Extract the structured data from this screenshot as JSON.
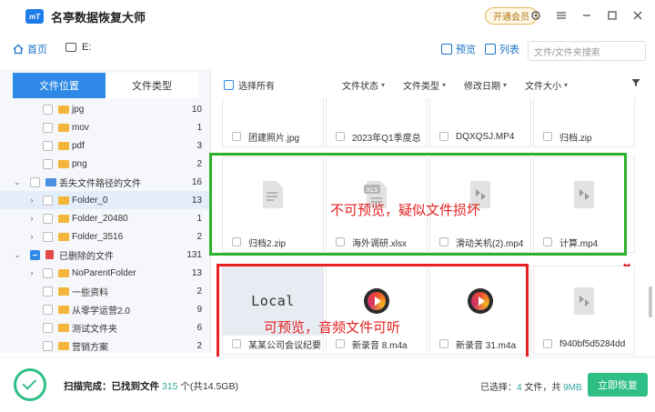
{
  "app": {
    "logo_text": "mT",
    "title": "名亭数据恢复大师",
    "vip_label": "开通会员"
  },
  "addressbar": {
    "home_label": "首页",
    "path": "E:",
    "view_preview": "预览",
    "view_list": "列表",
    "search_placeholder": "文件/文件夹搜索"
  },
  "left_tabs": {
    "location": "文件位置",
    "type": "文件类型"
  },
  "tree": [
    {
      "label": "jpg",
      "count": "10",
      "level": 2
    },
    {
      "label": "mov",
      "count": "1",
      "level": 2
    },
    {
      "label": "pdf",
      "count": "3",
      "level": 2
    },
    {
      "label": "png",
      "count": "2",
      "level": 2
    },
    {
      "label": "丢失文件路径的文件",
      "count": "16",
      "level": 1
    },
    {
      "label": "Folder_0",
      "count": "13",
      "level": 2
    },
    {
      "label": "Folder_20480",
      "count": "1",
      "level": 2
    },
    {
      "label": "Folder_3516",
      "count": "2",
      "level": 2
    },
    {
      "label": "已删除的文件",
      "count": "131",
      "level": 1
    },
    {
      "label": "NoParentFolder",
      "count": "13",
      "level": 2
    },
    {
      "label": "一些资料",
      "count": "2",
      "level": 2
    },
    {
      "label": "从零学运营2.0",
      "count": "9",
      "level": 2
    },
    {
      "label": "测试文件夹",
      "count": "6",
      "level": 2
    },
    {
      "label": "营销方案",
      "count": "2",
      "level": 2
    }
  ],
  "toolbar": {
    "select_all": "选择所有",
    "sort_status": "文件状态",
    "sort_type": "文件类型",
    "sort_date": "修改日期",
    "sort_size": "文件大小"
  },
  "files": {
    "row1": [
      "团建照片.jpg",
      "2023年Q1季度总",
      "DQXQSJ.MP4",
      "归档.zip"
    ],
    "row2": [
      "归档2.zip",
      "海外调研.xlsx",
      "滑动关机(2).mp4",
      "计算.mp4"
    ],
    "row3": [
      "某某公司会议纪要",
      "新录音 8.m4a",
      "新录音 31.m4a",
      "f940bf5d5284dd"
    ],
    "xls_badge": "XLS",
    "local_thumb_text": "Local"
  },
  "annotations": {
    "green_note": "不可预览，疑似文件损坏",
    "red_note": "可预览，音频文件可听"
  },
  "footer": {
    "scan_done": "扫描完成：",
    "found_label": "已找到文件",
    "found_count": "315",
    "found_unit": "个(共14.5GB)",
    "selected_label": "已选择：",
    "selected_count": "4",
    "selected_mid": "文件，共",
    "selected_size": "9MB",
    "recover_button": "立即恢复"
  },
  "colors": {
    "accent": "#2e8ae6",
    "success": "#2fbf86",
    "green_box": "#2bb12b",
    "red_box": "#e62222"
  }
}
